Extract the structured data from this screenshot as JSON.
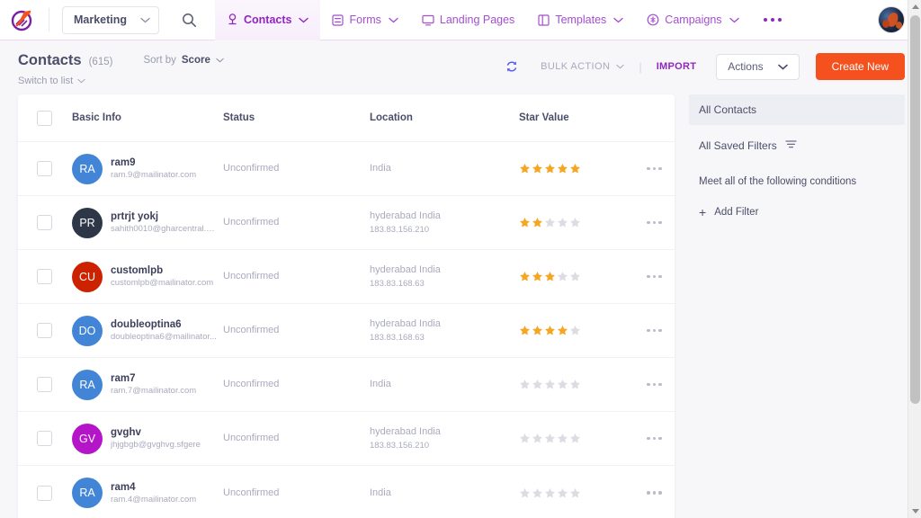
{
  "nav": {
    "logo_icon": "growth-logo-icon",
    "workspace": {
      "label": "Marketing",
      "icon": "chevron-down-icon"
    },
    "search_icon": "search-icon",
    "items": [
      {
        "label": "Contacts",
        "icon": "contact-person-icon",
        "active": true,
        "caret": true
      },
      {
        "label": "Forms",
        "icon": "form-icon",
        "active": false,
        "caret": true
      },
      {
        "label": "Landing Pages",
        "icon": "monitor-icon",
        "active": false,
        "caret": false
      },
      {
        "label": "Templates",
        "icon": "template-icon",
        "active": false,
        "caret": true
      },
      {
        "label": "Campaigns",
        "icon": "campaign-icon",
        "active": false,
        "caret": true
      }
    ],
    "more_icon": "ellipsis-icon",
    "avatar_icon": "user-avatar"
  },
  "toolbar": {
    "title": "Contacts",
    "count": "(615)",
    "switch_to_list": "Switch to list",
    "sort_by_label": "Sort by",
    "sort_by_value": "Score",
    "refresh_icon": "refresh-icon",
    "bulk_action": "BULK ACTION",
    "divider": "|",
    "import": "IMPORT",
    "actions": "Actions",
    "create_new": "Create New"
  },
  "table": {
    "columns": [
      "Basic Info",
      "Status",
      "Location",
      "Star Value"
    ],
    "rows": [
      {
        "initials": "RA",
        "color": "#4285d6",
        "name": "ram9",
        "email": "ram.9@mailinator.com",
        "status": "Unconfirmed",
        "location": "India",
        "ip": "",
        "stars": 5
      },
      {
        "initials": "PR",
        "color": "#2d3748",
        "name": "prtrjt yokj",
        "email": "sahith0010@gharcentral.co...",
        "status": "Unconfirmed",
        "location": "hyderabad India",
        "ip": "183.83.156.210",
        "stars": 2
      },
      {
        "initials": "CU",
        "color": "#cc2200",
        "name": "customlpb",
        "email": "customlpb@mailinator.com",
        "status": "Unconfirmed",
        "location": "hyderabad India",
        "ip": "183.83.168.63",
        "stars": 3
      },
      {
        "initials": "DO",
        "color": "#4285d6",
        "name": "doubleoptina6",
        "email": "doubleoptina6@mailinator...",
        "status": "Unconfirmed",
        "location": "hyderabad India",
        "ip": "183.83.168.63",
        "stars": 4
      },
      {
        "initials": "RA",
        "color": "#4285d6",
        "name": "ram7",
        "email": "ram.7@mailinator.com",
        "status": "Unconfirmed",
        "location": "India",
        "ip": "",
        "stars": 0
      },
      {
        "initials": "GV",
        "color": "#b515c9",
        "name": "gvghv",
        "email": "jhjgbgb@gvghvg.sfgere",
        "status": "Unconfirmed",
        "location": "hyderabad India",
        "ip": "183.83.156.210",
        "stars": 0
      },
      {
        "initials": "RA",
        "color": "#4285d6",
        "name": "ram4",
        "email": "ram.4@mailinator.com",
        "status": "Unconfirmed",
        "location": "India",
        "ip": "",
        "stars": 0
      }
    ],
    "row_menu_icon": "ellipsis-menu-icon",
    "max_stars": 5
  },
  "filter_panel": {
    "all_contacts": "All Contacts",
    "all_saved_filters": "All Saved Filters",
    "filter_icon": "filter-icon",
    "conditions_text": "Meet all of the following conditions",
    "add_filter": "Add Filter",
    "add_icon": "plus-icon"
  },
  "colors": {
    "brand_purple": "#9026bd",
    "accent_orange": "#f4511e",
    "star_gold": "#f5a623",
    "star_empty": "#dcdce2",
    "text_dark": "#4b4e68",
    "text_muted": "#a9abbd"
  }
}
